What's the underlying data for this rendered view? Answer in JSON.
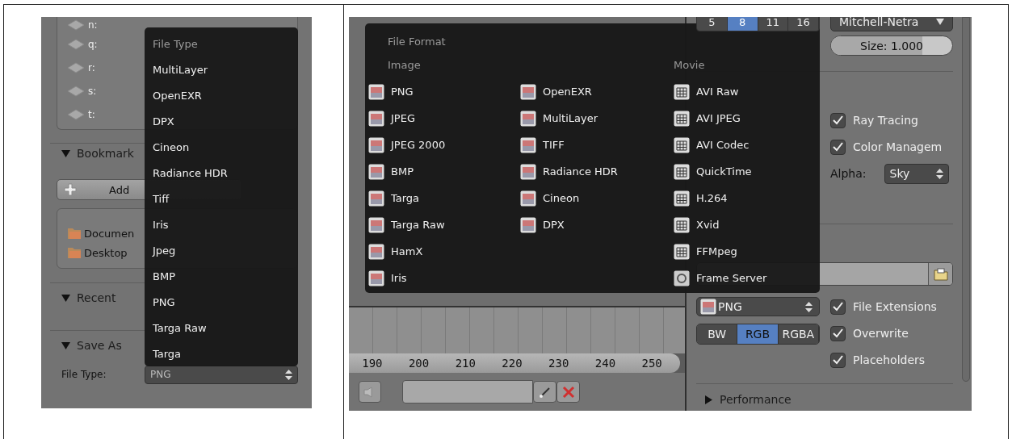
{
  "left_screenshot": {
    "drives": [
      {
        "label": "n:"
      },
      {
        "label": "q:"
      },
      {
        "label": "r:"
      },
      {
        "label": "s:"
      },
      {
        "label": "t:"
      }
    ],
    "bookmarks_panel": {
      "title": "Bookmark",
      "expanded": true,
      "add_button": "Add",
      "items": [
        "Documen",
        "Desktop"
      ]
    },
    "recent_panel": {
      "title": "Recent",
      "expanded": true
    },
    "save_as_panel": {
      "title": "Save As",
      "expanded": true,
      "file_type_label": "File Type:",
      "file_type_value": "PNG"
    },
    "menu": {
      "title": "File Type",
      "items": [
        "MultiLayer",
        "OpenEXR",
        "DPX",
        "Cineon",
        "Radiance HDR",
        "Tiff",
        "Iris",
        "Jpeg",
        "BMP",
        "PNG",
        "Targa Raw",
        "Targa"
      ]
    }
  },
  "right_screenshot": {
    "samples": [
      {
        "label": "5",
        "selected": false
      },
      {
        "label": "8",
        "selected": true
      },
      {
        "label": "11",
        "selected": false
      },
      {
        "label": "16",
        "selected": false
      }
    ],
    "filter": "Mitchell-Netra",
    "size": {
      "label": "Size: 1.000",
      "level": 0.75
    },
    "menu": {
      "title": "File Format",
      "columns": [
        {
          "heading": "Image",
          "items": [
            {
              "label": "PNG",
              "kind": "image"
            },
            {
              "label": "JPEG",
              "kind": "image"
            },
            {
              "label": "JPEG 2000",
              "kind": "image"
            },
            {
              "label": "BMP",
              "kind": "image"
            },
            {
              "label": "Targa",
              "kind": "image"
            },
            {
              "label": "Targa Raw",
              "kind": "image"
            },
            {
              "label": "HamX",
              "kind": "image"
            },
            {
              "label": "Iris",
              "kind": "image"
            }
          ]
        },
        {
          "items": [
            {
              "label": "OpenEXR",
              "kind": "image"
            },
            {
              "label": "MultiLayer",
              "kind": "image"
            },
            {
              "label": "TIFF",
              "kind": "image"
            },
            {
              "label": "Radiance HDR",
              "kind": "image"
            },
            {
              "label": "Cineon",
              "kind": "image"
            },
            {
              "label": "DPX",
              "kind": "image"
            }
          ]
        },
        {
          "heading": "Movie",
          "items": [
            {
              "label": "AVI Raw",
              "kind": "movie"
            },
            {
              "label": "AVI JPEG",
              "kind": "movie"
            },
            {
              "label": "AVI Codec",
              "kind": "movie"
            },
            {
              "label": "QuickTime",
              "kind": "movie"
            },
            {
              "label": "H.264",
              "kind": "movie"
            },
            {
              "label": "Xvid",
              "kind": "movie"
            },
            {
              "label": "FFMpeg",
              "kind": "movie"
            },
            {
              "label": "Frame Server",
              "kind": "server"
            }
          ]
        }
      ]
    },
    "shading_options": [
      {
        "label": "Ray Tracing",
        "checked": true
      },
      {
        "label": "Color Managem",
        "checked": true
      }
    ],
    "alpha": {
      "label": "Alpha:",
      "value": "Sky"
    },
    "output": {
      "format": "PNG",
      "color_modes": [
        {
          "label": "BW",
          "selected": false
        },
        {
          "label": "RGB",
          "selected": true
        },
        {
          "label": "RGBA",
          "selected": false
        }
      ],
      "options": [
        {
          "label": "File Extensions",
          "checked": true
        },
        {
          "label": "Overwrite",
          "checked": true
        },
        {
          "label": "Placeholders",
          "checked": true
        }
      ]
    },
    "ruler": [
      "190",
      "200",
      "210",
      "220",
      "230",
      "240",
      "250"
    ],
    "performance_panel": {
      "title": "Performance",
      "expanded": false
    }
  }
}
